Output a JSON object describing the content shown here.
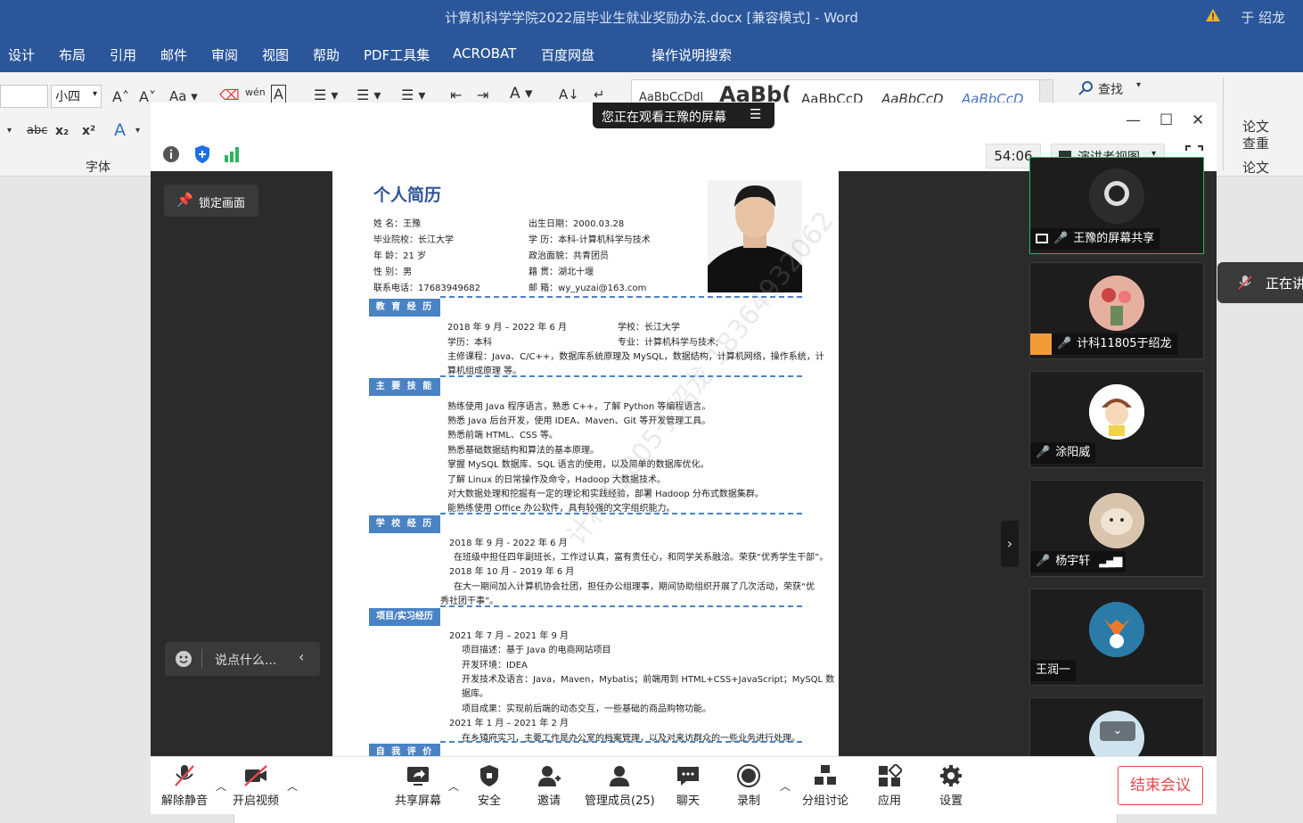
{
  "word": {
    "title": "计算机科学学院2022届毕业生就业奖励办法.docx [兼容模式]  -  Word",
    "user": "于 绍龙",
    "menu": [
      "设计",
      "布局",
      "引用",
      "邮件",
      "审阅",
      "视图",
      "帮助",
      "PDF工具集",
      "ACROBAT",
      "百度网盘",
      "操作说明搜索"
    ],
    "font_size": "小四",
    "font_group_label": "字体",
    "find_label": "查找",
    "styles_preview": [
      "AaBbCcDdl",
      "AaBb(",
      "AaBbCcD",
      "AaBbCcD",
      "AaBbCcD"
    ],
    "paper_check": [
      "论文",
      "查重",
      "论文"
    ]
  },
  "meeting": {
    "share_banner": "您正在观看王豫的屏幕",
    "timer": "54:06",
    "view_mode": "演讲者视图",
    "lock_label": "锁定画面",
    "say_placeholder": "说点什么...",
    "participants": [
      {
        "name": "王豫的屏幕共享",
        "avatar_color": "#3b3b3b"
      },
      {
        "name": "计科11805于绍龙",
        "avatar_color": "#d98b78"
      },
      {
        "name": "涂阳威",
        "avatar_color": "#f4d5b8"
      },
      {
        "name": "杨宇轩",
        "avatar_color": "#e8d7c4"
      },
      {
        "name": "王润一",
        "avatar_color": "#2a7ba8"
      }
    ],
    "side_card": "正在讲",
    "toolbar": [
      {
        "label": "解除静音",
        "icon": "mic-muted-icon"
      },
      {
        "label": "开启视频",
        "icon": "video-off-icon"
      },
      {
        "label": "共享屏幕",
        "icon": "share-screen-icon"
      },
      {
        "label": "安全",
        "icon": "shield-icon"
      },
      {
        "label": "邀请",
        "icon": "invite-icon"
      },
      {
        "label": "管理成员(25)",
        "icon": "members-icon"
      },
      {
        "label": "聊天",
        "icon": "chat-icon"
      },
      {
        "label": "录制",
        "icon": "record-icon"
      },
      {
        "label": "分组讨论",
        "icon": "breakout-icon"
      },
      {
        "label": "应用",
        "icon": "apps-icon"
      },
      {
        "label": "设置",
        "icon": "gear-icon"
      }
    ],
    "end_label": "结束会议"
  },
  "resume": {
    "title": "个人简历",
    "info": [
      "姓  名：王豫",
      "出生日期：2000.03.28",
      "毕业院校：长江大学",
      "学  历：本科-计算机科学与技术",
      "年  龄：21 岁",
      "政治面貌：共青团员",
      "性  别：男",
      "籍  贯：湖北十堰",
      "联系电话：17683949682",
      "邮  箱：wy_yuzai@163.com"
    ],
    "sections": [
      "教 育 经 历",
      "主 要 技 能",
      "学 校 经 历",
      "项目/实习经历",
      "自 我 评 价"
    ],
    "education": [
      "2018 年 9 月  –  2022 年 6 月",
      "学校：长江大学",
      "学历：本科",
      "专业：计算机科学与技术;",
      "主修课程：Java、C/C++，数据库系统原理及 MySQL，数据结构，计算机网络，操作系统，计",
      "算机组成原理  等。"
    ],
    "skills": [
      "熟练使用 Java 程序语言，熟悉 C++，了解 Python 等编程语言。",
      "熟悉 Java 后台开发，使用 IDEA、Maven、Git 等开发管理工具。",
      "熟悉前端 HTML、CSS 等。",
      "熟悉基础数据结构和算法的基本原理。",
      "掌握 MySQL 数据库、SQL 语言的使用，以及简单的数据库优化。",
      "了解 Linux 的日常操作及命令，Hadoop 大数据技术。",
      "对大数据处理和挖掘有一定的理论和实践经验，部署 Hadoop 分布式数据集群。",
      "能熟练使用 Office 办公软件，具有较强的文字组织能力。"
    ],
    "school": [
      "2018 年 9 月  - 2022 年 6 月",
      "在班级中担任四年副班长，工作过认真，富有责任心，和同学关系融洽。荣获“优秀学生干部”。",
      "2018 年 10 月  – 2019 年 6 月",
      "在大一期间加入计算机协会社团，担任办公组理事，期间协助组织开展了几次活动，荣获“优",
      "秀社团干事”。"
    ],
    "projects": [
      "2021 年 7 月  – 2021 年 9 月",
      "项目描述：基于 Java 的电商网站项目",
      "开发环境：IDEA",
      "开发技术及语言：Java，Maven，Mybatis；前端用到 HTML+CSS+JavaScript；MySQL 数",
      "据库。",
      "项目成果：实现前后端的动态交互，一些基础的商品购物功能。",
      "2021 年 1 月  – 2021 年 2 月",
      "在乡镇府实习，主要工作是办公室的档案管理，以及对来访群众的一些业务进行处理。"
    ],
    "watermark": "计科11805于绍龙 18364932062"
  }
}
